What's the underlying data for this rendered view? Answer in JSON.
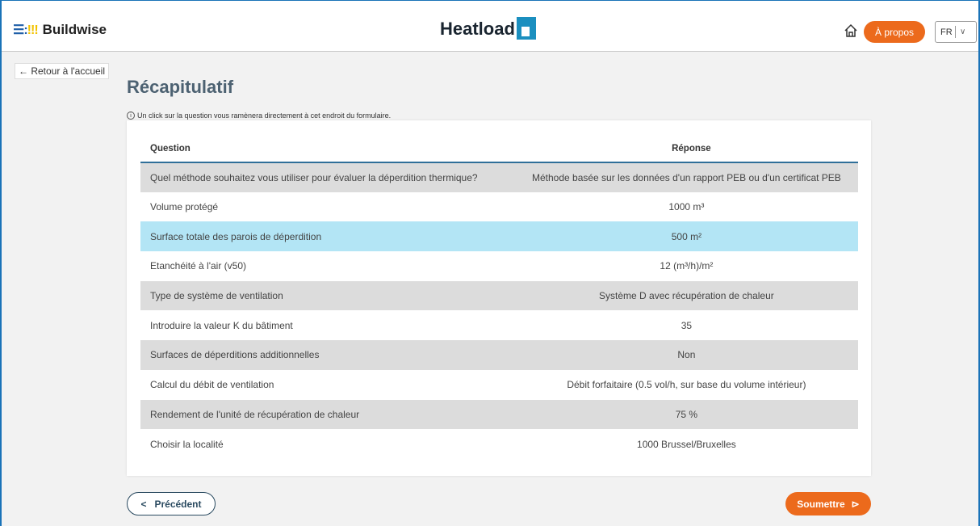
{
  "header": {
    "logo_mark_a": "☰:",
    "logo_mark_b": "!!!",
    "logo_text": "Buildwise",
    "brand": "Heatload",
    "about_label": "À propos",
    "lang_value": "FR",
    "lang_chevron": "∨"
  },
  "nav": {
    "back_label": "← Retour à l'accueil"
  },
  "page": {
    "title": "Récapitulatif",
    "info_icon": "i",
    "info_note": "Un click sur la question vous ramènera directement à cet endroit du formulaire."
  },
  "table": {
    "col_question": "Question",
    "col_response": "Réponse",
    "rows": [
      {
        "q": "Quel méthode souhaitez vous utiliser pour évaluer la déperdition thermique?",
        "a": "Méthode basée sur les données d'un rapport PEB ou d'un certificat PEB"
      },
      {
        "q": "Volume protégé",
        "a": "1000 m³"
      },
      {
        "q": "Surface totale des parois de déperdition",
        "a": "500 m²"
      },
      {
        "q": "Etanchéité à l'air (v50)",
        "a": "12 (m³/h)/m²"
      },
      {
        "q": "Type de système de ventilation",
        "a": "Système D avec récupération de chaleur"
      },
      {
        "q": "Introduire la valeur K du bâtiment",
        "a": "35"
      },
      {
        "q": "Surfaces de déperditions additionnelles",
        "a": "Non"
      },
      {
        "q": "Calcul du débit de ventilation",
        "a": "Débit forfaitaire (0.5 vol/h, sur base du volume intérieur)"
      },
      {
        "q": "Rendement de l'unité de récupération de chaleur",
        "a": "75 %"
      },
      {
        "q": "Choisir la localité",
        "a": "1000 Brussel/Bruxelles"
      }
    ]
  },
  "footer": {
    "prev_icon": "<",
    "prev_label": "Précédent",
    "submit_label": "Soumettre",
    "submit_icon": "⊳"
  },
  "colors": {
    "accent": "#ec6a1c",
    "highlight_row": "#b3e5f5",
    "title": "#4d6272"
  }
}
